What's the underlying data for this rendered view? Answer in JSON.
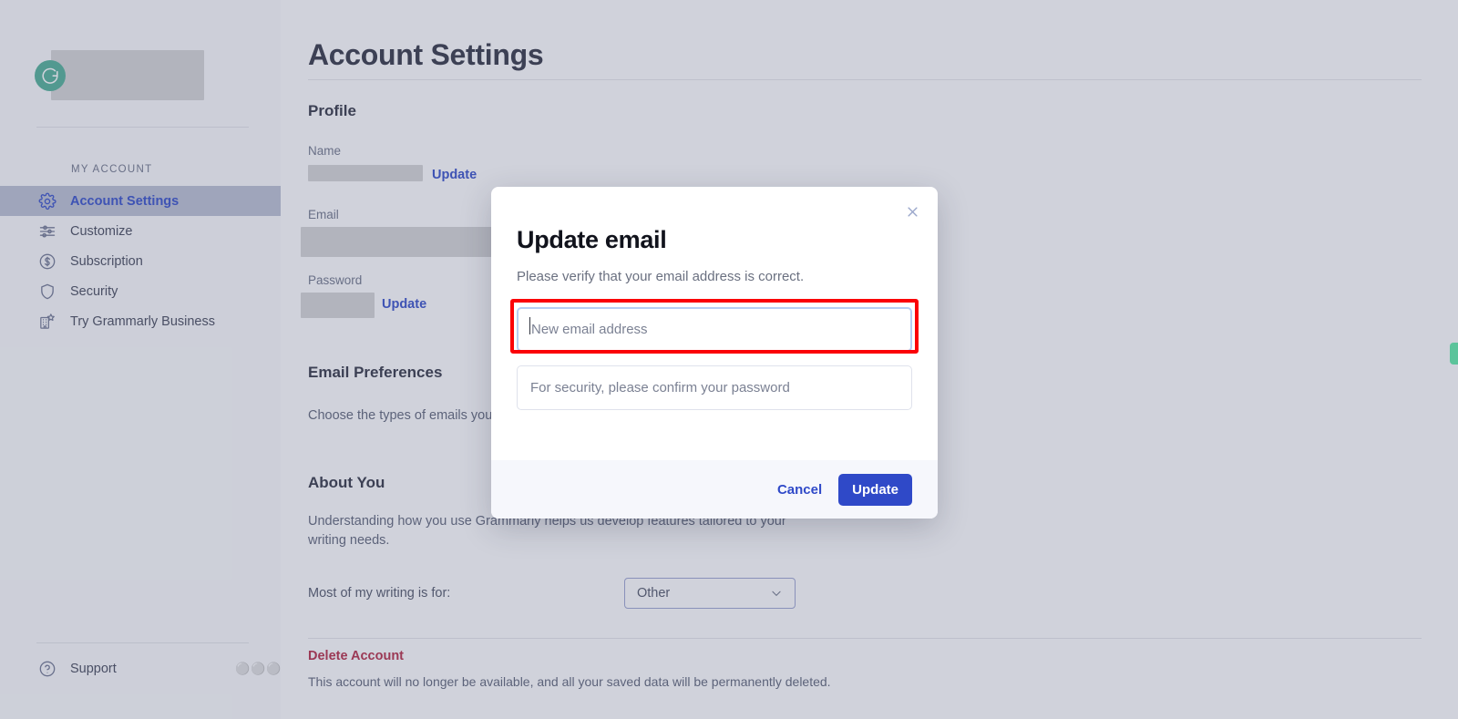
{
  "sidebar": {
    "brand": {
      "logo_icon": "grammarly-g-icon",
      "logo_color": "#4bae94",
      "account_name_redacted": ""
    },
    "section_label": "MY ACCOUNT",
    "items": [
      {
        "label": "Account Settings",
        "icon": "gear-icon",
        "active": true
      },
      {
        "label": "Customize",
        "icon": "sliders-icon",
        "active": false
      },
      {
        "label": "Subscription",
        "icon": "dollar-circle-icon",
        "active": false
      },
      {
        "label": "Security",
        "icon": "shield-icon",
        "active": false
      },
      {
        "label": "Try Grammarly Business",
        "icon": "building-star-icon",
        "active": false
      }
    ],
    "support": {
      "label": "Support",
      "icon": "question-circle-icon",
      "overflow_icon": "more-dots-icon"
    }
  },
  "main": {
    "page_title": "Account Settings",
    "profile": {
      "heading": "Profile",
      "name_label": "Name",
      "name_value_redacted": "",
      "name_update_label": "Update",
      "email_label": "Email",
      "email_value_redacted": "",
      "password_label": "Password",
      "password_value_redacted": "",
      "password_update_label": "Update"
    },
    "email_preferences": {
      "heading": "Email Preferences",
      "description": "Choose the types of emails you"
    },
    "about_you": {
      "heading": "About You",
      "description": "Understanding how you use Grammarly helps us develop features tailored to your writing needs.",
      "writing_for_label": "Most of my writing is for:",
      "writing_for_value": "Other",
      "writing_for_chevron": "chevron-down-icon"
    },
    "delete_account": {
      "title": "Delete Account",
      "description": "This account will no longer be available, and all your saved data will be permanently deleted.",
      "color": "#b3243f"
    }
  },
  "feedback_tab": {
    "name": "feedback-tab",
    "color": "#5cc49b"
  },
  "modal": {
    "title": "Update email",
    "subtitle": "Please verify that your email address is correct.",
    "close_icon": "close-icon",
    "email_input": {
      "value": "",
      "placeholder": "New email address",
      "focused": true
    },
    "password_input": {
      "value": "",
      "placeholder": "For security, please confirm your password",
      "focused": false
    },
    "cancel_label": "Cancel",
    "update_label": "Update",
    "accent_color": "#2f49c8"
  },
  "annotation": {
    "type": "highlight-rectangle",
    "color": "#fb0007",
    "target": "email-input"
  }
}
